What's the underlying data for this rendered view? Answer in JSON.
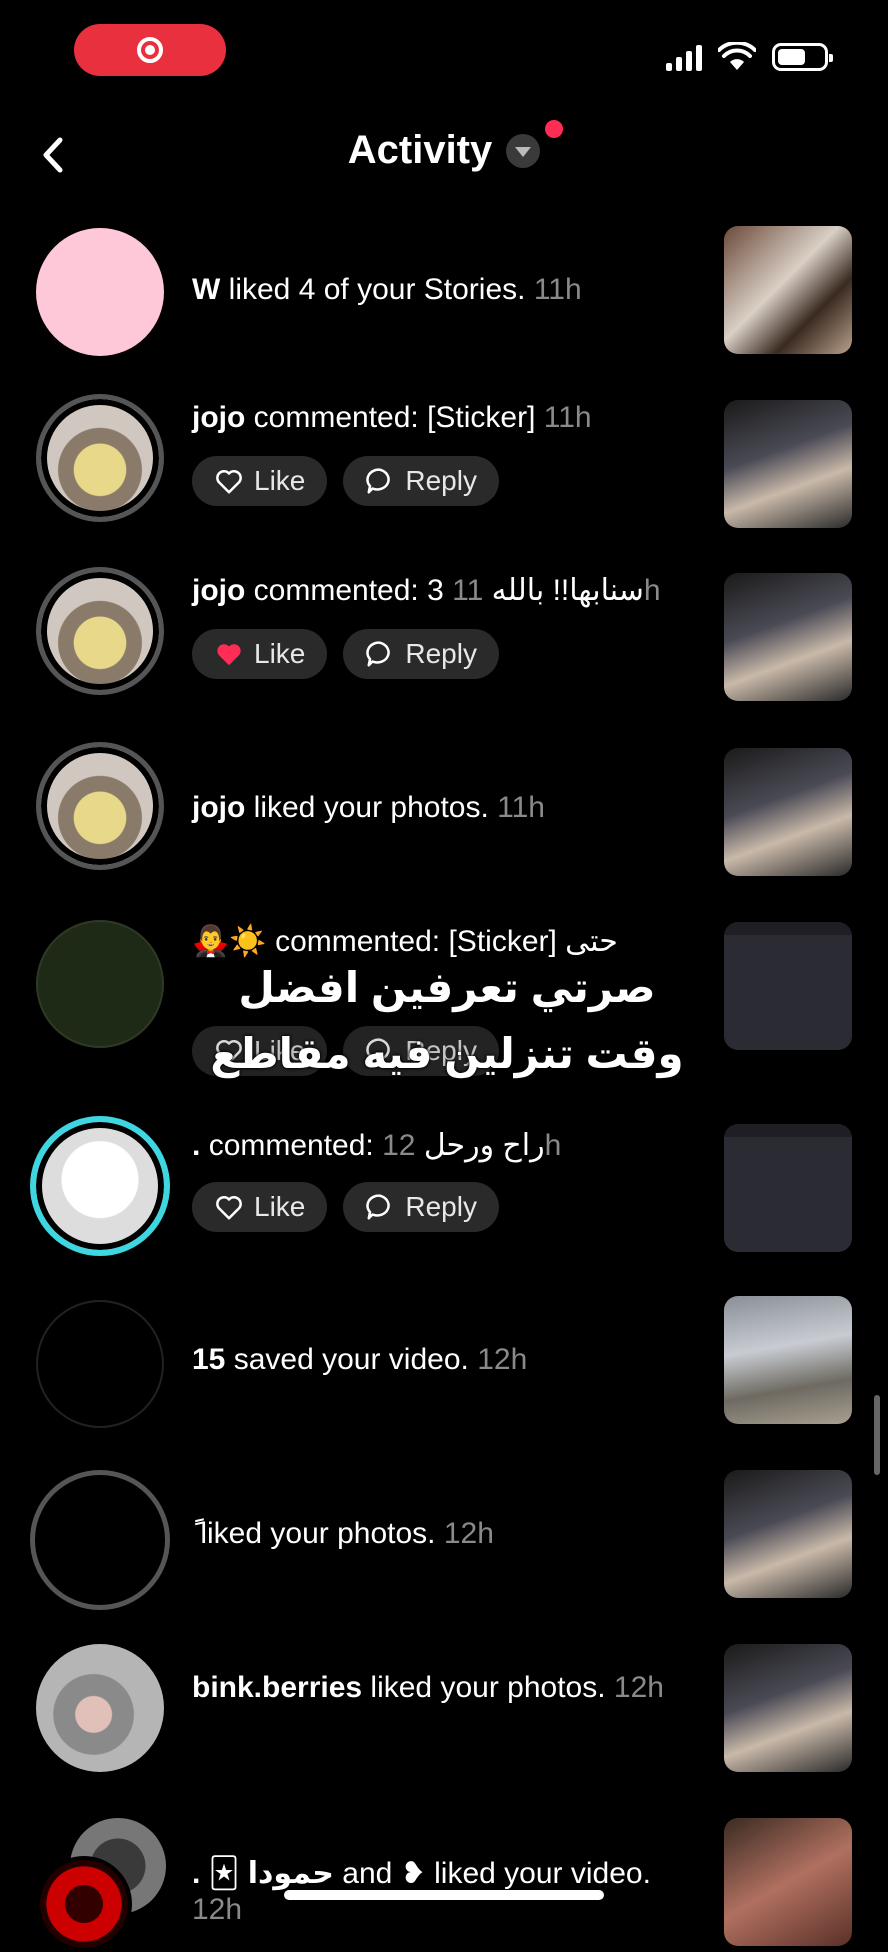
{
  "header": {
    "title": "Activity"
  },
  "actions": {
    "like": "Like",
    "reply": "Reply"
  },
  "rows": [
    {
      "user": "W",
      "action": "liked 4 of your Stories.",
      "time": "11h"
    },
    {
      "user": "jojo",
      "action": "commented: [Sticker]",
      "time": "11h"
    },
    {
      "user": "jojo",
      "action": "commented: 3 سنابها!! بالله",
      "time": "11h"
    },
    {
      "user": "jojo",
      "action": "liked your photos.",
      "time": "11h"
    },
    {
      "user": "🧛‍♂️☀️",
      "action": "commented: [Sticker] حتى",
      "time": ""
    },
    {
      "user": ".",
      "action": "commented: راح ورحل",
      "time": "12h"
    },
    {
      "user": "15",
      "action": "saved your video.",
      "time": "12h"
    },
    {
      "user": "ً",
      "action": "liked your photos.",
      "time": "12h"
    },
    {
      "user": "bink.berries",
      "action": "liked your photos.",
      "time": "12h"
    },
    {
      "user": ". 🃏 حمودا",
      "action": "and ❥ liked your video.",
      "time": "12h"
    }
  ],
  "overlay_caption": "صرتي تعرفين افضل وقت تنزلين فيه مقاطع",
  "colors": {
    "accent": "#ff2c55",
    "record": "#e8303f",
    "liked": "#ff2c55"
  }
}
